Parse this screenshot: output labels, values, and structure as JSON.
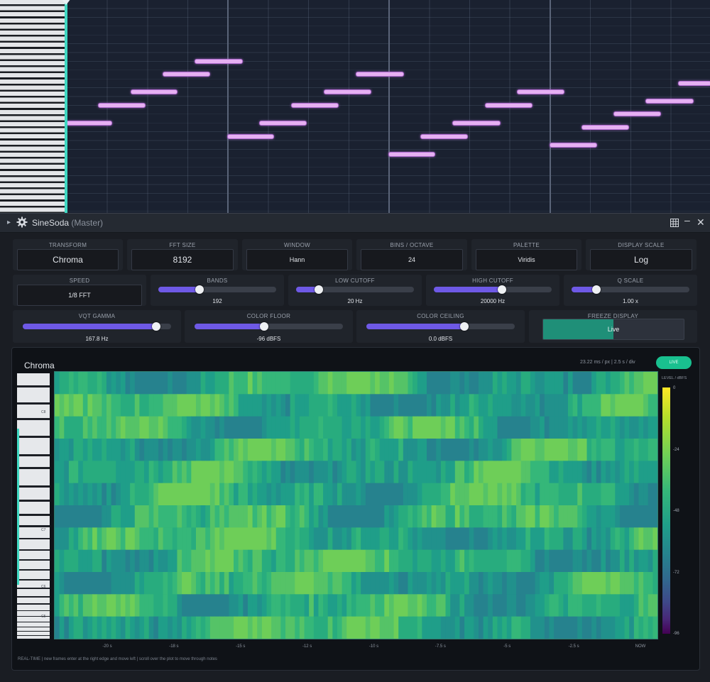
{
  "window": {
    "title": "SineSoda",
    "subtitle": "(Master)"
  },
  "controls": {
    "transform": {
      "label": "TRANSFORM",
      "value": "Chroma"
    },
    "fft_size": {
      "label": "FFT SIZE",
      "value": "8192"
    },
    "window_fn": {
      "label": "WINDOW",
      "value": "Hann"
    },
    "bins_per_octave": {
      "label": "BINS / OCTAVE",
      "value": "24"
    },
    "palette": {
      "label": "PALETTE",
      "value": "Viridis"
    },
    "display_scale": {
      "label": "DISPLAY SCALE",
      "value": "Log"
    },
    "speed": {
      "label": "SPEED",
      "value": "1/8 FFT"
    },
    "bands": {
      "label": "BANDS",
      "value": "192",
      "level": 0.35
    },
    "low_cutoff": {
      "label": "LOW CUTOFF",
      "value": "20 Hz",
      "level": 0.19
    },
    "high_cutoff": {
      "label": "HIGH CUTOFF",
      "value": "20000 Hz",
      "level": 0.58
    },
    "q_scale": {
      "label": "Q SCALE",
      "value": "1.00 x",
      "level": 0.21
    },
    "vqt_gamma": {
      "label": "VQT GAMMA",
      "value": "167.8 Hz",
      "level": 0.9
    },
    "color_floor": {
      "label": "COLOR FLOOR",
      "value": "-96 dBFS",
      "level": 0.47
    },
    "color_ceiling": {
      "label": "COLOR CEILING",
      "value": "0.0 dBFS",
      "level": 0.66
    },
    "freeze_display": {
      "label": "FREEZE DISPLAY",
      "value": "Live",
      "level": 0.5
    }
  },
  "display": {
    "title": "Chroma",
    "info": "23.22 ms / px  |  2.5 s / div",
    "live_badge": "LIVE",
    "level_label": "LEVEL / dBFS",
    "colorbar_ticks": [
      "0",
      "-24",
      "-48",
      "-72",
      "-96"
    ],
    "x_ticks": [
      "-20 s",
      "-18 s",
      "-15 s",
      "-12 s",
      "-10 s",
      "-7.5 s",
      "-5 s",
      "-2.5 s",
      "NOW"
    ],
    "key_labels": [
      "C8",
      "C7",
      "C6",
      "C5"
    ],
    "footer": "REAL-TIME  |  new frames enter at the right edge and move left  |  scroll over the plot to move through notes"
  },
  "icons": {
    "expand": "triangle-right-icon",
    "settings": "gear-icon",
    "grid": "grid-icon",
    "minimize": "minimize-icon",
    "close": "close-icon"
  },
  "colors": {
    "accent_slider": "#6e59e6",
    "live_green": "#19c08f",
    "playhead": "#3fd8c2",
    "note": "#e6b0f2"
  }
}
